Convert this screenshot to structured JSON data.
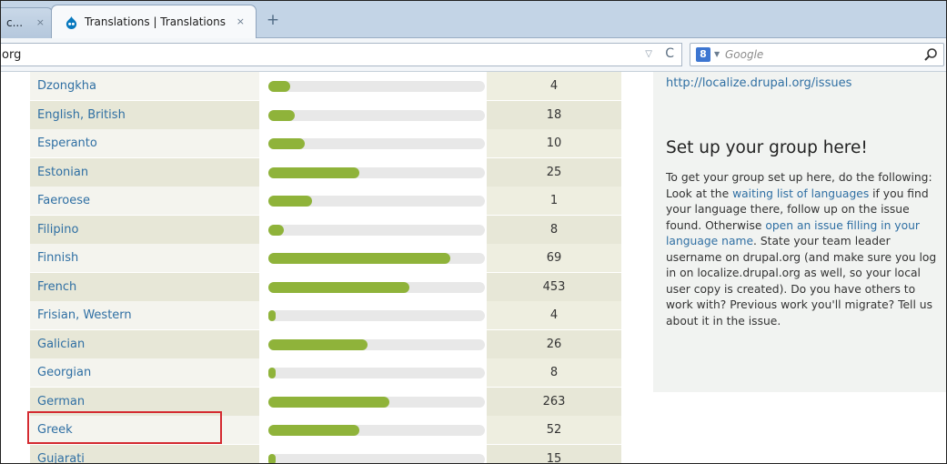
{
  "browser": {
    "prev_tab_label": "c...",
    "prev_tab_close": "×",
    "active_tab_title": "Translations | Translations",
    "active_tab_close": "×",
    "new_tab_glyph": "+",
    "url": "org",
    "search_placeholder": "Google",
    "search_engine_badge": "8"
  },
  "languages": [
    {
      "name": "Dzongkha",
      "count": "4",
      "progress": 0.1
    },
    {
      "name": "English, British",
      "count": "18",
      "progress": 0.12
    },
    {
      "name": "Esperanto",
      "count": "10",
      "progress": 0.17
    },
    {
      "name": "Estonian",
      "count": "25",
      "progress": 0.42
    },
    {
      "name": "Faeroese",
      "count": "1",
      "progress": 0.2
    },
    {
      "name": "Filipino",
      "count": "8",
      "progress": 0.07
    },
    {
      "name": "Finnish",
      "count": "69",
      "progress": 0.84
    },
    {
      "name": "French",
      "count": "453",
      "progress": 0.65
    },
    {
      "name": "Frisian, Western",
      "count": "4",
      "progress": 0.03
    },
    {
      "name": "Galician",
      "count": "26",
      "progress": 0.46
    },
    {
      "name": "Georgian",
      "count": "8",
      "progress": 0.02
    },
    {
      "name": "German",
      "count": "263",
      "progress": 0.56
    },
    {
      "name": "Greek",
      "count": "52",
      "progress": 0.42
    },
    {
      "name": "Gujarati",
      "count": "15",
      "progress": 0.02
    }
  ],
  "sidebar": {
    "issues_link": "http://localize.drupal.org/issues",
    "heading": "Set up your group here!",
    "p1": "To get your group set up here, do the following: Look at the ",
    "link_waiting": "waiting list of languages",
    "p2": " if you find your language there, follow up on the issue found. Otherwise ",
    "link_open_issue": "open an issue filling in your language name",
    "p3": ". State your team leader username on drupal.org (and make sure you log in on localize.drupal.org as well, so your local user copy is created). Do you have others to work with? Previous work you'll migrate? Tell us about it in the issue."
  },
  "colors": {
    "link": "#2f6fa3",
    "bar_fill": "#8fb33a",
    "highlight": "#d42a30"
  }
}
